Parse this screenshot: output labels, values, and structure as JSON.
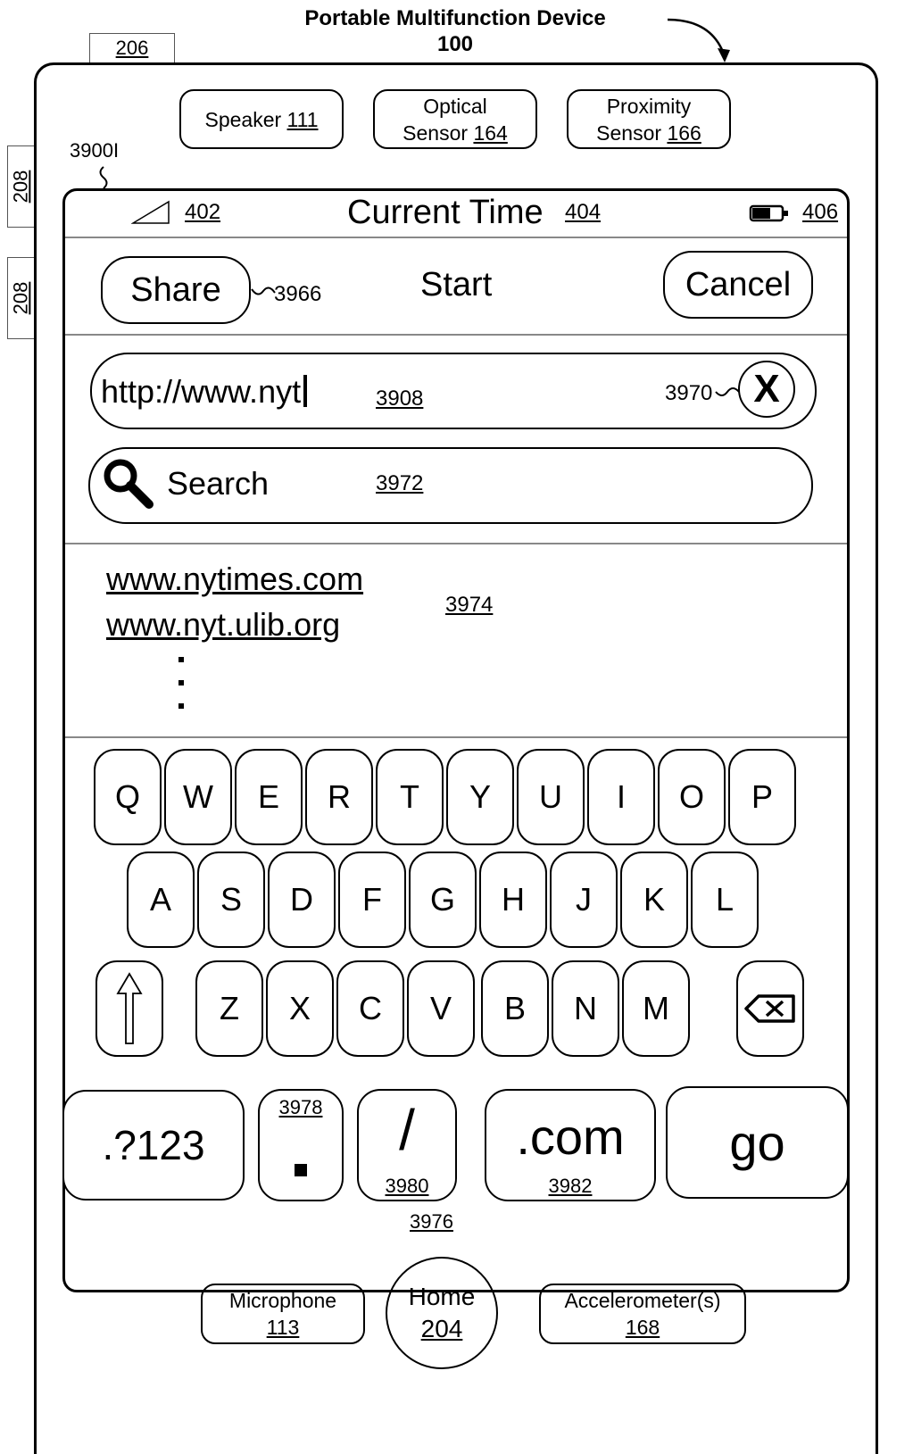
{
  "header": {
    "title_line1": "Portable Multifunction Device",
    "title_line2": "100",
    "label_206": "206",
    "label_208a": "208",
    "label_208b": "208",
    "label_screen": "3900I"
  },
  "hardware_top": [
    {
      "text": "Speaker",
      "ref": "111"
    },
    {
      "line1": "Optical",
      "text": "Sensor",
      "ref": "164"
    },
    {
      "line1": "Proximity",
      "text": "Sensor",
      "ref": "166"
    }
  ],
  "status_bar": {
    "signal_ref": "402",
    "time": "Current Time",
    "time_ref": "404",
    "battery_ref": "406"
  },
  "toolbar": {
    "share_label": "Share",
    "share_ref": "3966",
    "title": "Start",
    "cancel_label": "Cancel"
  },
  "url_field": {
    "value": "http://www.nyt",
    "ref": "3908",
    "clear_ref": "3970",
    "clear_glyph": "X"
  },
  "search_field": {
    "placeholder": "Search",
    "ref": "3972"
  },
  "suggestions": {
    "items": [
      "www.nytimes.com",
      "www.nyt.ulib.org"
    ],
    "ref": "3974"
  },
  "keyboard": {
    "row1": [
      "Q",
      "W",
      "E",
      "R",
      "T",
      "Y",
      "U",
      "I",
      "O",
      "P"
    ],
    "row2": [
      "A",
      "S",
      "D",
      "F",
      "G",
      "H",
      "J",
      "K",
      "L"
    ],
    "row3": [
      "Z",
      "X",
      "C",
      "V",
      "B",
      "N",
      "M"
    ],
    "numbers_key": ".?123",
    "dot_ref": "3978",
    "slash_key": "/",
    "slash_ref": "3980",
    "com_key": ".com",
    "com_ref": "3982",
    "go_key": "go",
    "bottom_row_ref": "3976"
  },
  "hardware_bottom": {
    "microphone": "Microphone",
    "microphone_ref": "113",
    "home": "Home",
    "home_ref": "204",
    "accelerometer": "Accelerometer(s)",
    "accelerometer_ref": "168"
  }
}
